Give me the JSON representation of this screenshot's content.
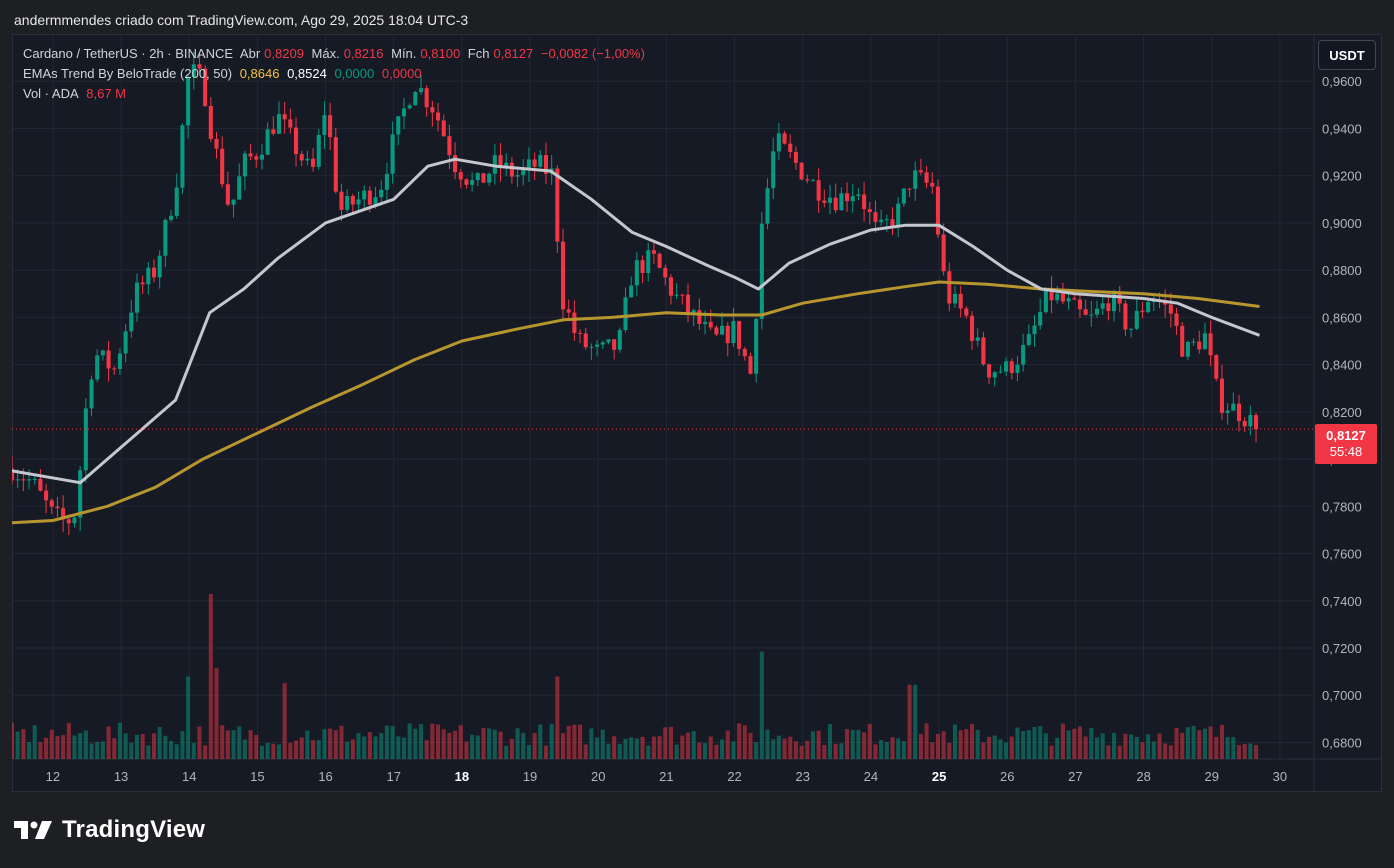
{
  "header": {
    "author_line": "andermmendes criado com TradingView.com, Ago 29, 2025 18:04 UTC-3"
  },
  "legend": {
    "symbol": "Cardano / TetherUS · 2h · BINANCE",
    "open_label": "Abr",
    "open_value": "0,8209",
    "high_label": "Máx.",
    "high_value": "0,8216",
    "low_label": "Mín.",
    "low_value": "0,8100",
    "close_label": "Fch",
    "close_value": "0,8127",
    "change": "−0,0082 (−1,00%)",
    "ema_name": "EMAs Trend By BeloTrade (200, 50)",
    "ema_v1": "0,8646",
    "ema_v2": "0,8524",
    "ema_v3": "0,0000",
    "ema_v4": "0,0000",
    "vol_label": "Vol · ADA",
    "vol_value": "8,67 M"
  },
  "currency_button": "USDT",
  "last_price": {
    "price": "0,8127",
    "countdown": "55:48"
  },
  "brand": {
    "name": "TradingView"
  },
  "colors": {
    "up": "#089981",
    "down": "#f23645",
    "ema50": "#c5c7cf",
    "ema200": "#b8962e",
    "background": "#161a25",
    "grid": "#232733"
  },
  "icons": {
    "logo": "tradingview-logo-icon"
  },
  "chart_data": {
    "type": "candlestick",
    "y_axis": {
      "ticks": [
        0.68,
        0.7,
        0.72,
        0.74,
        0.76,
        0.78,
        0.8,
        0.82,
        0.84,
        0.86,
        0.88,
        0.9,
        0.92,
        0.94,
        0.96
      ],
      "tick_labels": [
        "0,6800",
        "0,7000",
        "0,7200",
        "0,7400",
        "0,7600",
        "0,7800",
        "0,8000",
        "0,8200",
        "0,8400",
        "0,8600",
        "0,8800",
        "0,9000",
        "0,9200",
        "0,9400",
        "0,9600"
      ],
      "range": [
        0.673,
        0.98
      ]
    },
    "x_axis": {
      "range": [
        11.4,
        30.5
      ],
      "ticks": [
        12,
        13,
        14,
        15,
        16,
        17,
        18,
        19,
        20,
        21,
        22,
        23,
        24,
        25,
        26,
        27,
        28,
        29,
        30
      ],
      "tick_labels": [
        "12",
        "13",
        "14",
        "15",
        "16",
        "17",
        "18",
        "19",
        "20",
        "21",
        "22",
        "23",
        "24",
        "25",
        "26",
        "27",
        "28",
        "29",
        "30"
      ],
      "bold_ticks": [
        "18",
        "25"
      ]
    },
    "ohlc_anchors_day_close": [
      [
        11.4,
        0.796
      ],
      [
        11.7,
        0.79
      ],
      [
        12.0,
        0.776
      ],
      [
        12.2,
        0.773
      ],
      [
        12.35,
        0.778
      ],
      [
        12.45,
        0.814
      ],
      [
        12.6,
        0.845
      ],
      [
        12.9,
        0.838
      ],
      [
        13.2,
        0.87
      ],
      [
        13.5,
        0.88
      ],
      [
        13.8,
        0.915
      ],
      [
        14.0,
        0.965
      ],
      [
        14.2,
        0.96
      ],
      [
        14.35,
        0.935
      ],
      [
        14.6,
        0.905
      ],
      [
        14.8,
        0.925
      ],
      [
        15.0,
        0.93
      ],
      [
        15.3,
        0.945
      ],
      [
        15.5,
        0.935
      ],
      [
        15.8,
        0.92
      ],
      [
        16.0,
        0.95
      ],
      [
        16.2,
        0.905
      ],
      [
        16.5,
        0.91
      ],
      [
        16.8,
        0.915
      ],
      [
        17.0,
        0.935
      ],
      [
        17.3,
        0.96
      ],
      [
        17.6,
        0.948
      ],
      [
        17.9,
        0.925
      ],
      [
        18.2,
        0.915
      ],
      [
        18.5,
        0.925
      ],
      [
        18.8,
        0.92
      ],
      [
        19.1,
        0.925
      ],
      [
        19.35,
        0.92
      ],
      [
        19.45,
        0.87
      ],
      [
        19.7,
        0.85
      ],
      [
        20.0,
        0.845
      ],
      [
        20.3,
        0.848
      ],
      [
        20.5,
        0.88
      ],
      [
        20.8,
        0.885
      ],
      [
        21.1,
        0.87
      ],
      [
        21.4,
        0.86
      ],
      [
        21.7,
        0.85
      ],
      [
        22.0,
        0.855
      ],
      [
        22.25,
        0.835
      ],
      [
        22.4,
        0.9
      ],
      [
        22.6,
        0.935
      ],
      [
        22.9,
        0.925
      ],
      [
        23.2,
        0.915
      ],
      [
        23.5,
        0.91
      ],
      [
        23.8,
        0.915
      ],
      [
        24.1,
        0.895
      ],
      [
        24.4,
        0.905
      ],
      [
        24.6,
        0.92
      ],
      [
        24.9,
        0.915
      ],
      [
        25.1,
        0.87
      ],
      [
        25.4,
        0.86
      ],
      [
        25.7,
        0.838
      ],
      [
        26.0,
        0.838
      ],
      [
        26.3,
        0.848
      ],
      [
        26.6,
        0.87
      ],
      [
        26.9,
        0.865
      ],
      [
        27.2,
        0.858
      ],
      [
        27.5,
        0.868
      ],
      [
        27.8,
        0.855
      ],
      [
        28.1,
        0.87
      ],
      [
        28.4,
        0.862
      ],
      [
        28.6,
        0.845
      ],
      [
        28.9,
        0.852
      ],
      [
        29.1,
        0.825
      ],
      [
        29.4,
        0.82
      ],
      [
        29.7,
        0.8127
      ]
    ],
    "ema50": [
      [
        11.4,
        0.795
      ],
      [
        12.4,
        0.79
      ],
      [
        13.0,
        0.805
      ],
      [
        13.8,
        0.825
      ],
      [
        14.3,
        0.862
      ],
      [
        14.8,
        0.872
      ],
      [
        15.3,
        0.885
      ],
      [
        16.0,
        0.9
      ],
      [
        16.5,
        0.905
      ],
      [
        17.0,
        0.91
      ],
      [
        17.5,
        0.924
      ],
      [
        17.9,
        0.927
      ],
      [
        18.5,
        0.924
      ],
      [
        19.3,
        0.922
      ],
      [
        19.9,
        0.91
      ],
      [
        20.5,
        0.896
      ],
      [
        21.0,
        0.89
      ],
      [
        21.6,
        0.882
      ],
      [
        22.0,
        0.877
      ],
      [
        22.35,
        0.872
      ],
      [
        22.8,
        0.883
      ],
      [
        23.4,
        0.891
      ],
      [
        24.0,
        0.897
      ],
      [
        24.5,
        0.899
      ],
      [
        25.0,
        0.899
      ],
      [
        25.5,
        0.89
      ],
      [
        26.0,
        0.88
      ],
      [
        26.5,
        0.872
      ],
      [
        27.0,
        0.87
      ],
      [
        27.5,
        0.869
      ],
      [
        28.0,
        0.868
      ],
      [
        28.5,
        0.866
      ],
      [
        29.0,
        0.86
      ],
      [
        29.7,
        0.8524
      ]
    ],
    "ema200": [
      [
        11.4,
        0.773
      ],
      [
        12.0,
        0.774
      ],
      [
        12.8,
        0.78
      ],
      [
        13.5,
        0.788
      ],
      [
        14.2,
        0.8
      ],
      [
        15.0,
        0.811
      ],
      [
        15.8,
        0.822
      ],
      [
        16.5,
        0.831
      ],
      [
        17.3,
        0.842
      ],
      [
        18.0,
        0.85
      ],
      [
        18.8,
        0.855
      ],
      [
        19.5,
        0.859
      ],
      [
        20.2,
        0.86
      ],
      [
        21.0,
        0.862
      ],
      [
        21.8,
        0.861
      ],
      [
        22.4,
        0.861
      ],
      [
        23.0,
        0.866
      ],
      [
        23.8,
        0.87
      ],
      [
        24.5,
        0.873
      ],
      [
        25.0,
        0.875
      ],
      [
        25.7,
        0.874
      ],
      [
        26.5,
        0.872
      ],
      [
        27.2,
        0.871
      ],
      [
        28.0,
        0.87
      ],
      [
        28.8,
        0.868
      ],
      [
        29.7,
        0.8646
      ]
    ],
    "volume_spikes": [
      [
        14.3,
        1.0
      ],
      [
        22.4,
        0.65
      ],
      [
        19.4,
        0.5
      ],
      [
        24.6,
        0.45
      ],
      [
        15.4,
        0.46
      ],
      [
        14.0,
        0.5
      ],
      [
        14.4,
        0.55
      ]
    ],
    "last_price": 0.8127,
    "grid": true,
    "legend_position": "top-left"
  }
}
